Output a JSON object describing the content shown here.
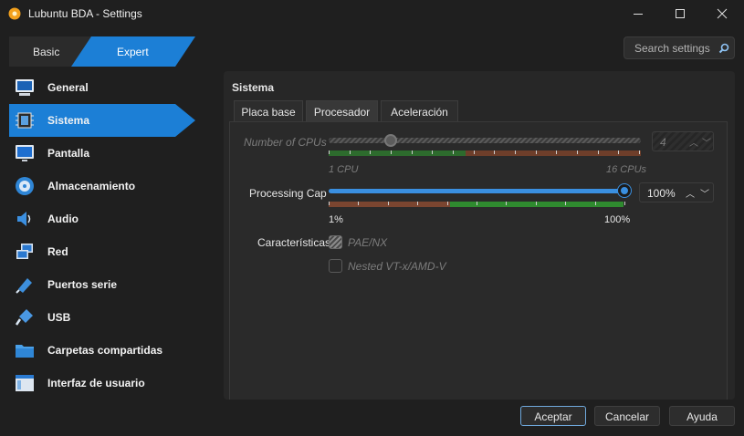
{
  "window": {
    "title": "Lubuntu BDA - Settings"
  },
  "mode_tabs": [
    {
      "label": "Basic"
    },
    {
      "label": "Expert"
    }
  ],
  "search": {
    "placeholder": "Search settings"
  },
  "sidebar": {
    "items": [
      {
        "label": "General",
        "icon": "monitor-general-icon"
      },
      {
        "label": "Sistema",
        "icon": "chip-icon",
        "active": true
      },
      {
        "label": "Pantalla",
        "icon": "display-icon"
      },
      {
        "label": "Almacenamiento",
        "icon": "disk-icon"
      },
      {
        "label": "Audio",
        "icon": "speaker-icon"
      },
      {
        "label": "Red",
        "icon": "network-icon"
      },
      {
        "label": "Puertos serie",
        "icon": "serial-port-icon"
      },
      {
        "label": "USB",
        "icon": "usb-icon"
      },
      {
        "label": "Carpetas compartidas",
        "icon": "folder-icon"
      },
      {
        "label": "Interfaz de usuario",
        "icon": "window-icon"
      }
    ]
  },
  "main": {
    "section_title": "Sistema",
    "tabs": [
      {
        "label": "Placa base"
      },
      {
        "label": "Procesador",
        "active": true
      },
      {
        "label": "Aceleración"
      }
    ],
    "cpu": {
      "label": "Number of CPUs",
      "value": "4",
      "current": 4,
      "min_label": "1 CPU",
      "max_label": "16 CPUs",
      "enabled": false
    },
    "cap": {
      "label": "Processing Cap",
      "value": "100%",
      "current_percent": 100,
      "min_label": "1%",
      "max_label": "100%"
    },
    "features": {
      "label": "Características",
      "pae_label": "PAE/NX",
      "nested_label": "Nested VT-x/AMD-V"
    }
  },
  "buttons": {
    "accept": "Aceptar",
    "cancel": "Cancelar",
    "help": "Ayuda"
  },
  "colors": {
    "accent": "#1c7fd6",
    "green": "#3a9a3a",
    "brown": "#8a4f34"
  }
}
